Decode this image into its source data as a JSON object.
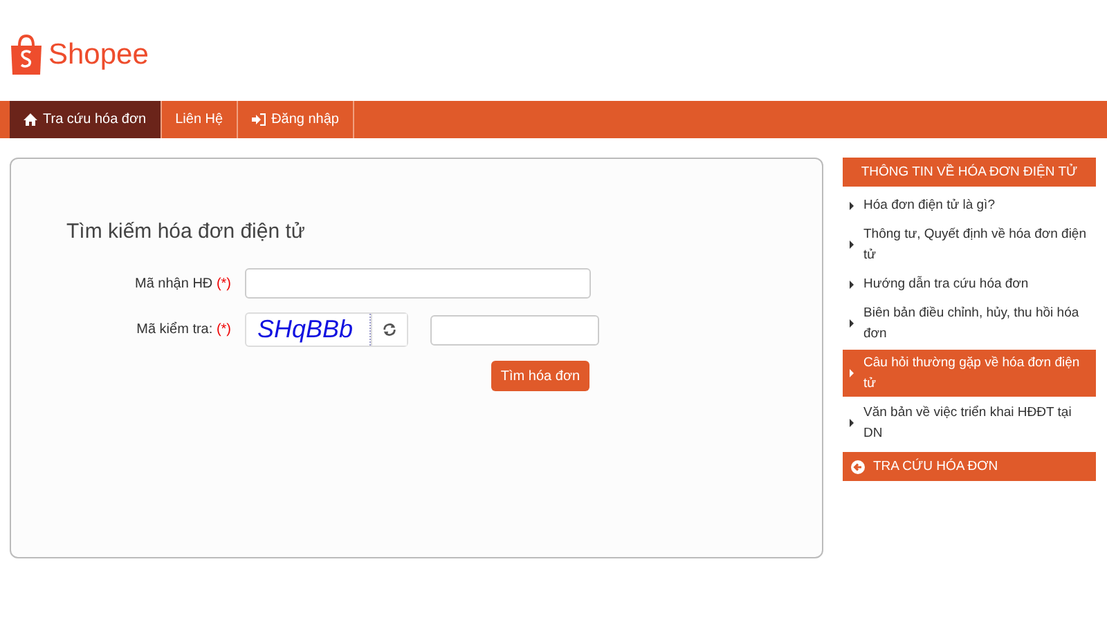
{
  "logo": {
    "text": "Shopee"
  },
  "nav": [
    {
      "label": "Tra cứu hóa đơn",
      "kind": "home",
      "selected": true
    },
    {
      "label": "Liên Hệ",
      "kind": "plain",
      "selected": false
    },
    {
      "label": "Đăng nhập",
      "kind": "login",
      "selected": false
    }
  ],
  "search_form": {
    "title": "Tìm kiếm hóa đơn điện tử",
    "fields": [
      {
        "kind": "text",
        "label": "Mã nhận HĐ",
        "required_mark": "(*)"
      },
      {
        "kind": "captcha",
        "label": "Mã kiểm tra:",
        "required_mark": "(*)",
        "captcha": "SHqBBb"
      }
    ],
    "submit": "Tìm hóa đơn"
  },
  "sidebar": {
    "title": "THÔNG TIN VỀ HÓA ĐƠN ĐIỆN TỬ",
    "items": [
      {
        "label": "Hóa đơn điện tử là gì?",
        "selected": false
      },
      {
        "label": "Thông tư, Quyết định về hóa đơn điện tử",
        "selected": false
      },
      {
        "label": "Hướng dẫn tra cứu hóa đơn",
        "selected": false
      },
      {
        "label": "Biên bản điều chỉnh, hủy, thu hồi hóa đơn",
        "selected": false
      },
      {
        "label": "Câu hỏi thường gặp về hóa đơn điện tử",
        "selected": true
      },
      {
        "label": "Văn bản về việc triển khai HĐĐT tại DN",
        "selected": false
      }
    ],
    "footer_button": "TRA CỨU HÓA ĐƠN"
  }
}
